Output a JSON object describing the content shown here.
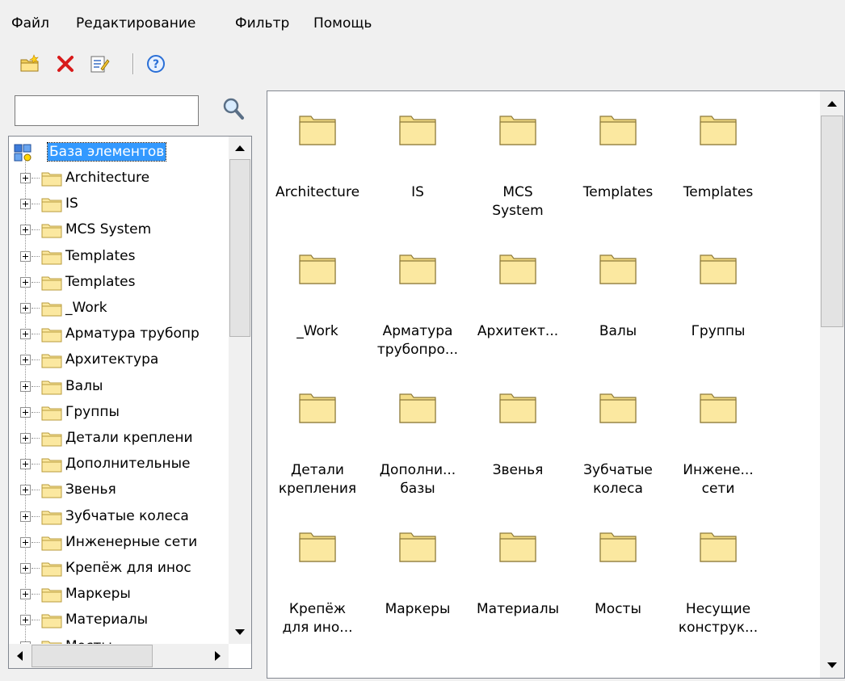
{
  "menu": {
    "items": [
      "Файл",
      "Редактирование",
      "Фильтр",
      "Помощь"
    ]
  },
  "toolbar": {
    "buttons": [
      {
        "icon": "new-folder-icon",
        "tooltip": ""
      },
      {
        "icon": "delete-icon",
        "tooltip": ""
      },
      {
        "icon": "properties-icon",
        "tooltip": ""
      },
      {
        "icon": "help-icon",
        "tooltip": ""
      }
    ]
  },
  "search": {
    "value": "",
    "placeholder": ""
  },
  "tree": {
    "root": "База элементов",
    "items": [
      "Architecture",
      "IS",
      "MCS System",
      "Templates",
      "Templates",
      "_Work",
      "Арматура трубопр",
      "Архитектура",
      "Валы",
      "Группы",
      "Детали креплени",
      "Дополнительные",
      "Звенья",
      "Зубчатые колеса",
      "Инженерные сети",
      "Крепёж для инос",
      "Маркеры",
      "Материалы",
      "Мосты"
    ]
  },
  "grid": {
    "items": [
      "Architecture",
      "IS",
      "MCS\nSystem",
      "Templates",
      "Templates",
      "_Work",
      "Арматура\nтрубопро...",
      "Архитект...",
      "Валы",
      "Группы",
      "Детали\nкрепления",
      "Дополни...\nбазы",
      "Звенья",
      "Зубчатые\nколеса",
      "Инжене...\nсети",
      "Крепёж\nдля ино...",
      "Маркеры",
      "Материалы",
      "Мосты",
      "Несущие\nконструк..."
    ]
  },
  "colors": {
    "folder_fill": "#fbe8a0",
    "folder_stroke": "#b89b3c",
    "selection": "#3399ff",
    "delete_red": "#d81b1b",
    "help_blue": "#2a6fd6"
  }
}
